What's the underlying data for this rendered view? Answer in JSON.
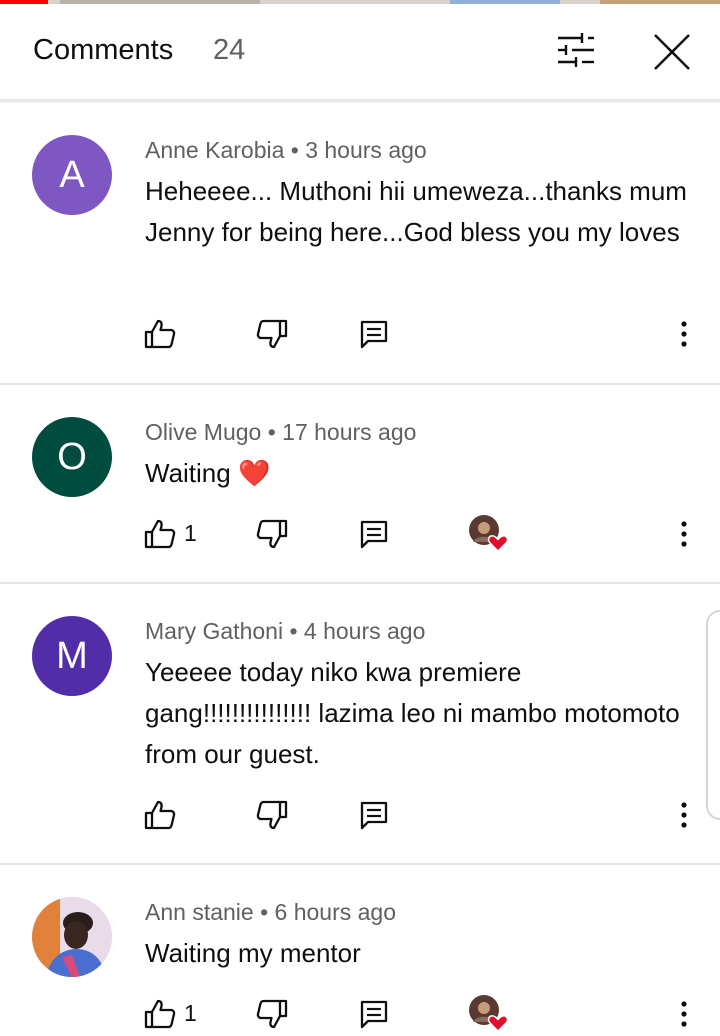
{
  "header": {
    "title": "Comments",
    "count": "24"
  },
  "colors": {
    "avatar_a": "#7e57c2",
    "avatar_o": "#004d40",
    "avatar_m": "#512da8",
    "heart": "#e10d2a"
  },
  "comments": [
    {
      "initial": "A",
      "author": "Anne Karobia",
      "time": "3 hours ago",
      "meta": "Anne Karobia • 3 hours ago",
      "text": "Heheeee... Muthoni hii umeweza...thanks mum Jenny for being here...God bless you my loves",
      "likes": "",
      "hearted": false
    },
    {
      "initial": "O",
      "author": "Olive Mugo",
      "time": "17 hours ago",
      "meta": "Olive Mugo • 17 hours ago",
      "text": "Waiting ❤️",
      "likes": "1",
      "hearted": true
    },
    {
      "initial": "M",
      "author": "Mary Gathoni",
      "time": "4 hours ago",
      "meta": "Mary Gathoni • 4 hours ago",
      "text": "Yeeeee today niko kwa premiere gang!!!!!!!!!!!!!!! lazima leo ni mambo motomoto from our guest.",
      "likes": "",
      "hearted": false
    },
    {
      "initial": "",
      "author": "Ann stanie",
      "time": "6 hours ago",
      "meta": "Ann stanie • 6 hours ago",
      "text": "Waiting my mentor",
      "likes": "1",
      "hearted": true
    }
  ]
}
